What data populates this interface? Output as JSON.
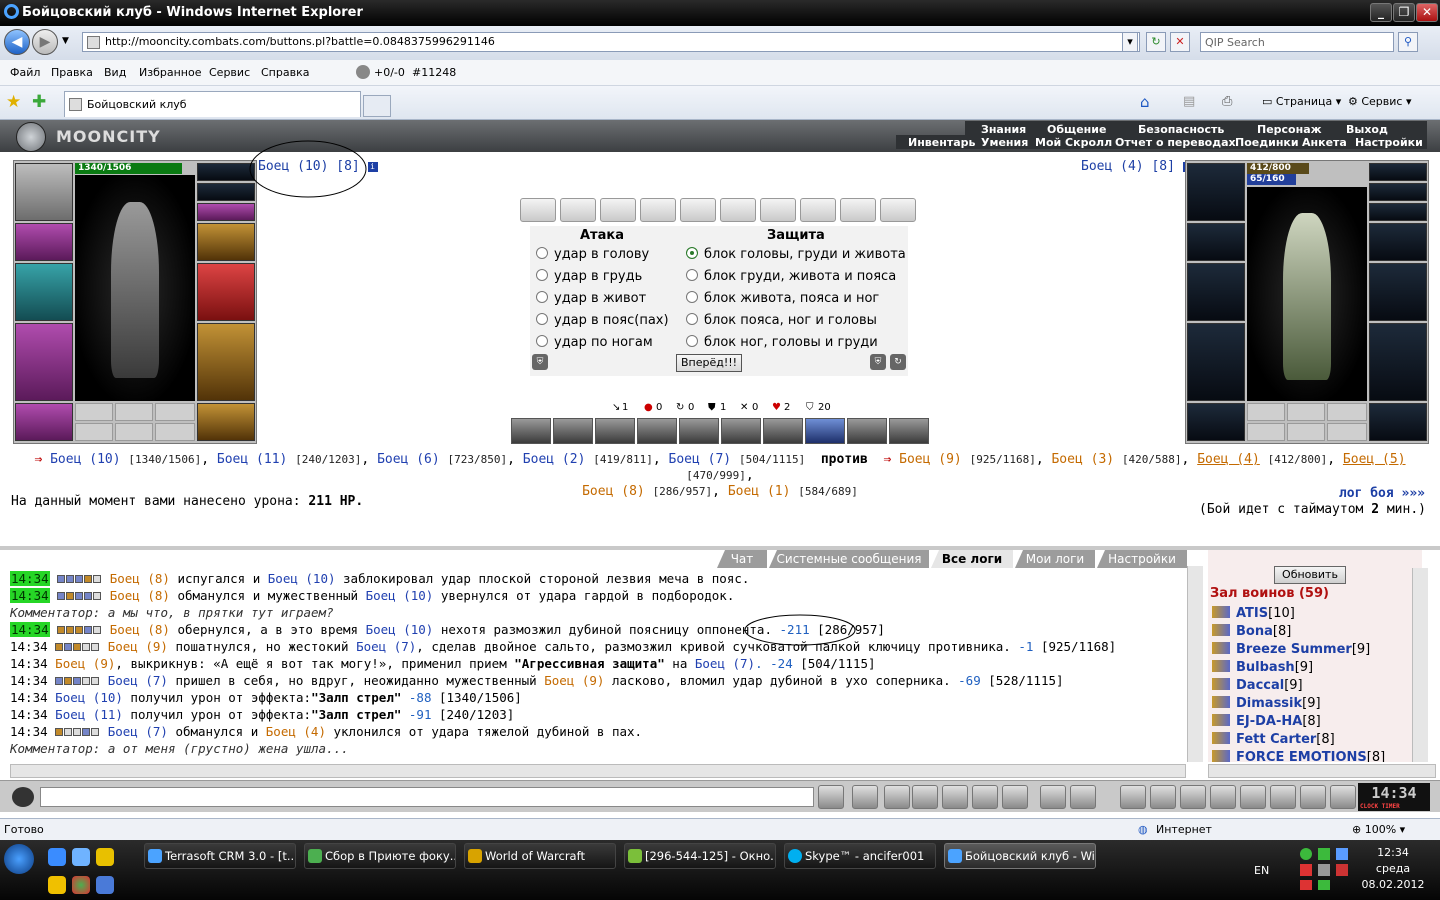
{
  "window": {
    "title": "Бойцовский клуб - Windows Internet Explorer",
    "url": "http://mooncity.combats.com/buttons.pl?battle=0.0848375996291146",
    "search_placeholder": "QIP Search",
    "menu": [
      "Файл",
      "Правка",
      "Вид",
      "Избранное",
      "Сервис",
      "Справка"
    ],
    "counter": "+0/-0",
    "counter_id": "#11248",
    "tab_title": "Бойцовский клуб",
    "toolbar_page": "Страница",
    "toolbar_service": "Сервис"
  },
  "game_menu": {
    "logo": "MOONCITY",
    "row1": [
      "Знания",
      "Общение",
      "Безопасность",
      "Персонаж",
      "Выход"
    ],
    "row2": [
      "Инвентарь",
      "Умения",
      "Мой Скролл",
      "Отчет о переводах",
      "Поединки",
      "Анкета",
      "Настройки"
    ]
  },
  "left_fighter": {
    "name": "Боец (10) [8]",
    "hp": "1340/1506",
    "hp_fraction": 0.89
  },
  "right_fighter": {
    "name": "Боец (4) [8]",
    "hp": "412/800",
    "hp_fraction": 0.52,
    "mp": "65/160",
    "mp_fraction": 0.41
  },
  "combat": {
    "attack_header": "Атака",
    "defense_header": "Защита",
    "attacks": [
      "удар в голову",
      "удар в грудь",
      "удар в живот",
      "удар в пояс(пах)",
      "удар по ногам"
    ],
    "defenses": [
      "блок головы, груди и живота",
      "блок груди, живота и пояса",
      "блок живота, пояса и ног",
      "блок пояса, ног и головы",
      "блок ног, головы и груди"
    ],
    "forward_button": "Вперёд!!!",
    "stats": [
      "1",
      "0",
      "0",
      "1",
      "0",
      "2",
      "20"
    ]
  },
  "teams": {
    "team1": [
      {
        "name": "Боец (10)",
        "hp": "[1340/1506]"
      },
      {
        "name": "Боец (11)",
        "hp": "[240/1203]"
      },
      {
        "name": "Боец (6)",
        "hp": "[723/850]"
      },
      {
        "name": "Боец (2)",
        "hp": "[419/811]"
      },
      {
        "name": "Боец (7)",
        "hp": "[504/1115]"
      }
    ],
    "versus": "против",
    "team2": [
      {
        "name": "Боец (9)",
        "hp": "[925/1168]"
      },
      {
        "name": "Боец (3)",
        "hp": "[420/588]"
      },
      {
        "name": "Боец (4)",
        "hp": "[412/800]"
      },
      {
        "name": "Боец (5)",
        "hp": "[470/999]"
      },
      {
        "name": "Боец (8)",
        "hp": "[286/957]"
      },
      {
        "name": "Боец (1)",
        "hp": "[584/689]"
      }
    ]
  },
  "damage_text": "На данный момент вами нанесено урона:",
  "damage_value": "211 HP.",
  "battle_log_link": "лог боя »»»",
  "timeout_text": "(Бой идет с таймаутом",
  "timeout_value": "2",
  "timeout_unit": "мин.)",
  "chat_tabs": [
    "Чат",
    "Системные сообщения",
    "Все логи",
    "Мои логи",
    "Настройки"
  ],
  "chat_lines": {
    "l1": {
      "ts": "14:34",
      "a": "Боец (8)",
      "t1": " испугался и ",
      "b": "Боец (10)",
      "t2": " заблокировал удар плоской стороной лезвия меча в пояс."
    },
    "l2": {
      "ts": "14:34",
      "a": "Боец (8)",
      "t1": " обманулся и мужественный ",
      "b": "Боец (10)",
      "t2": " увернулся от удара гардой в подбородок."
    },
    "l3": {
      "text": "Комментатор: а мы что, в прятки тут играем?"
    },
    "l4": {
      "ts": "14:34",
      "a": "Боец (8)",
      "t1": " обернулся, а в это время ",
      "b": "Боец (10)",
      "t2": " нехотя размозжил дубиной поясницу оппонента. ",
      "d": "-211",
      "hp": " [286/957]"
    },
    "l5": {
      "ts": "14:34",
      "a": "Боец (9)",
      "t1": " пошатнулся, но жестокий ",
      "b": "Боец (7)",
      "t2": ", сделав двойное сальто, размозжил кривой сучковатой палкой ключицу противника. ",
      "d": "-1",
      "hp": " [925/1168]"
    },
    "l6": {
      "ts": "14:34",
      "a": "Боец (9)",
      "t1": ", выкрикнув: «А ещё я вот так могу!», применил прием ",
      "s": "\"Агрессивная защита\"",
      "t2": " на ",
      "b": "Боец (7)",
      "d": ". -24",
      "hp": " [504/1115]"
    },
    "l7": {
      "ts": "14:34",
      "a": "Боец (7)",
      "t1": " пришел в себя, но вдруг, неожиданно мужественный ",
      "b": "Боец (9)",
      "t2": " ласково, вломил удар дубиной в ухо соперника. ",
      "d": "-69",
      "hp": " [528/1115]"
    },
    "l8": {
      "ts": "14:34",
      "a": "Боец (10)",
      "t1": " получил урон от эффекта:",
      "s": "\"Залп стрел\"",
      "d": " -88",
      "hp": " [1340/1506]"
    },
    "l9": {
      "ts": "14:34",
      "a": "Боец (11)",
      "t1": " получил урон от эффекта:",
      "s": "\"Залп стрел\"",
      "d": " -91",
      "hp": " [240/1203]"
    },
    "l10": {
      "ts": "14:34",
      "a": "Боец (7)",
      "t1": " обманулся и ",
      "b": "Боец (4)",
      "t2": " уклонился от удара тяжелой дубиной в пах."
    },
    "l11": {
      "text": "Комментатор: а от меня (грустно) жена ушла..."
    }
  },
  "room": {
    "refresh_button": "Обновить",
    "title": "Зал воинов (59)",
    "players": [
      {
        "name": "ATIS",
        "level": "[10]"
      },
      {
        "name": "Bona",
        "level": "[8]"
      },
      {
        "name": "Breeze Summer",
        "level": "[9]"
      },
      {
        "name": "Bulbash",
        "level": "[9]"
      },
      {
        "name": "Daccal",
        "level": "[9]"
      },
      {
        "name": "Dimassik",
        "level": "[9]"
      },
      {
        "name": "EJ-DA-HA",
        "level": "[8]"
      },
      {
        "name": "Fett Carter",
        "level": "[8]"
      },
      {
        "name": "FORCE EMOTIONS",
        "level": "[8]"
      }
    ]
  },
  "clock": {
    "time": "14:34",
    "label": "CLOCK TIMER"
  },
  "statusbar": {
    "left": "Готово",
    "zone": "Интернет",
    "zoom": "100%"
  },
  "taskbar": {
    "tasks": [
      "Terrasoft CRM 3.0 - [t...",
      "Сбор в Приюте фоку...",
      "World of Warcraft",
      "[296-544-125] - Окно...",
      "Skype™ - ancifer001",
      "Бойцовский клуб - Wi..."
    ],
    "lang": "EN",
    "time": "12:34",
    "day": "среда",
    "date": "08.02.2012"
  }
}
